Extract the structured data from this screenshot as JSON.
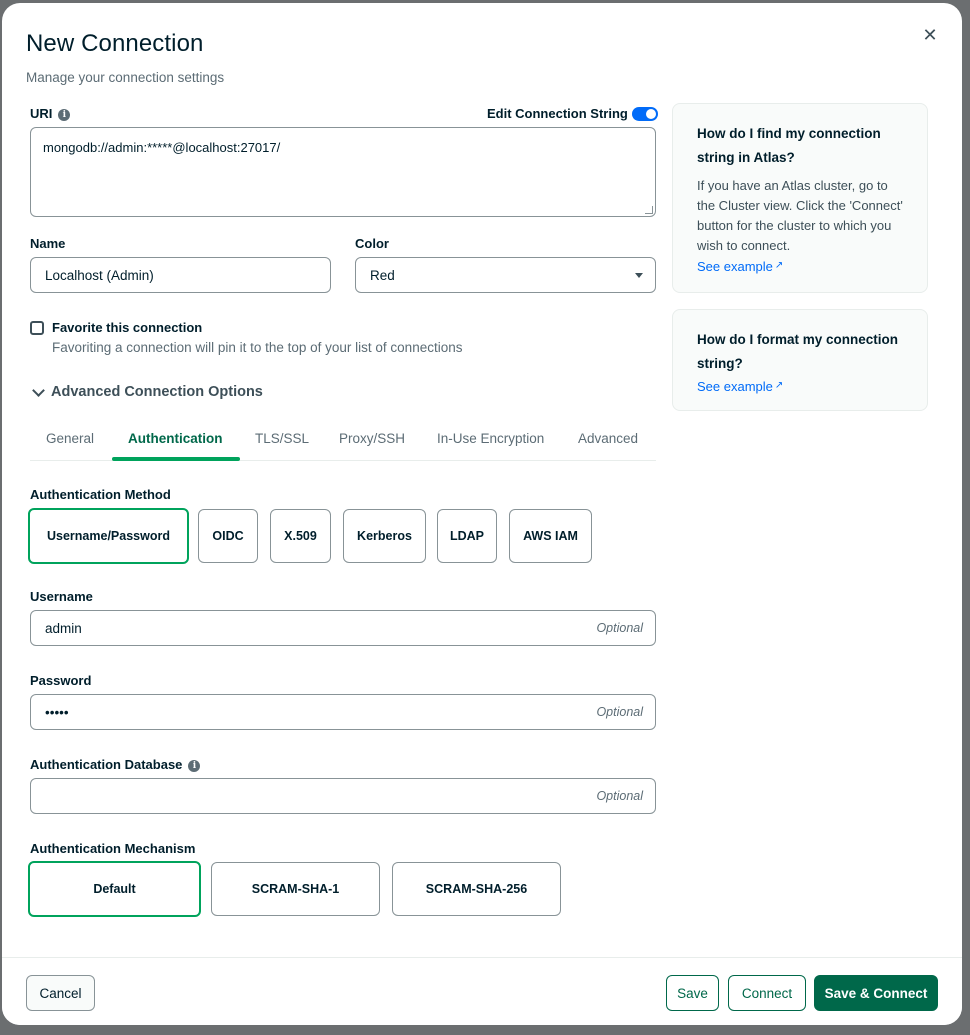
{
  "modal": {
    "title": "New Connection",
    "subtitle": "Manage your connection settings",
    "close_glyph": "✕"
  },
  "uri": {
    "label": "URI",
    "edit_toggle_label": "Edit Connection String",
    "edit_toggle_on": true,
    "value": "mongodb://admin:*****@localhost:27017/"
  },
  "name": {
    "label": "Name",
    "value": "Localhost (Admin)"
  },
  "color": {
    "label": "Color",
    "selected": "Red"
  },
  "favorite": {
    "label": "Favorite this connection",
    "description": "Favoriting a connection will pin it to the top of your list of connections",
    "checked": false
  },
  "advanced": {
    "label": "Advanced Connection Options",
    "tabs": [
      "General",
      "Authentication",
      "TLS/SSL",
      "Proxy/SSH",
      "In-Use Encryption",
      "Advanced"
    ],
    "active_tab": "Authentication"
  },
  "auth": {
    "method_label": "Authentication Method",
    "methods": [
      "Username/Password",
      "OIDC",
      "X.509",
      "Kerberos",
      "LDAP",
      "AWS IAM"
    ],
    "active_method": "Username/Password",
    "username": {
      "label": "Username",
      "value": "admin",
      "hint": "Optional"
    },
    "password": {
      "label": "Password",
      "value": "•••••",
      "hint": "Optional"
    },
    "database": {
      "label": "Authentication Database",
      "value": "",
      "hint": "Optional"
    },
    "mechanism_label": "Authentication Mechanism",
    "mechanisms": [
      "Default",
      "SCRAM-SHA-1",
      "SCRAM-SHA-256"
    ],
    "active_mechanism": "Default"
  },
  "help": [
    {
      "title": "How do I find my connection string in Atlas?",
      "body": "If you have an Atlas cluster, go to the Cluster view. Click the 'Connect' button for the cluster to which you wish to connect.",
      "link": "See example"
    },
    {
      "title": "How do I format my connection string?",
      "link": "See example"
    }
  ],
  "footer": {
    "cancel": "Cancel",
    "save": "Save",
    "connect": "Connect",
    "save_connect": "Save & Connect"
  },
  "colors": {
    "primary_green": "#00684a",
    "accent_green": "#00a35c",
    "link_blue": "#016bf8",
    "toggle_blue": "#016bf8"
  }
}
